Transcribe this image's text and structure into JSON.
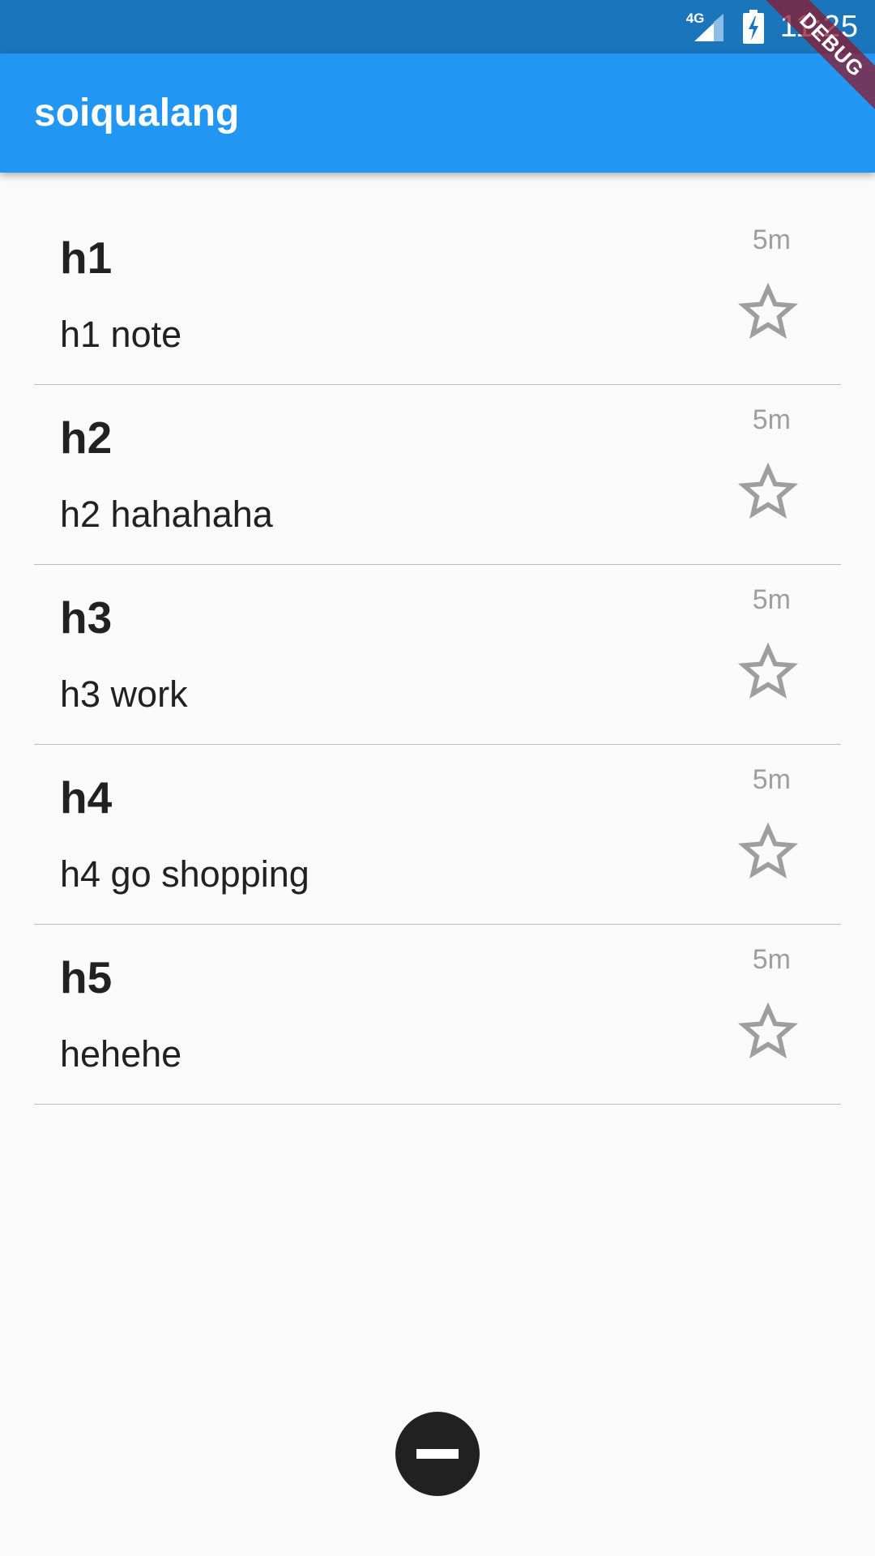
{
  "status_bar": {
    "network": "4G",
    "time": "11:25"
  },
  "app_bar": {
    "title": "soiqualang"
  },
  "debug_banner": "DEBUG",
  "notes": [
    {
      "title": "h1",
      "body": "h1 note",
      "time": "5m",
      "starred": false,
      "icon": "star-outline-icon"
    },
    {
      "title": "h2",
      "body": "h2 hahahaha",
      "time": "5m",
      "starred": false,
      "icon": "star-outline-icon"
    },
    {
      "title": "h3",
      "body": "h3 work",
      "time": "5m",
      "starred": false,
      "icon": "star-outline-icon"
    },
    {
      "title": "h4",
      "body": "h4 go shopping",
      "time": "5m",
      "starred": false,
      "icon": "star-outline-icon"
    },
    {
      "title": "h5",
      "body": "hehehe",
      "time": "5m",
      "starred": false,
      "icon": "star-outline-icon"
    }
  ],
  "fab": {
    "icon": "remove-circle-icon"
  },
  "colors": {
    "status_bar": "#1b75bb",
    "app_bar": "#2196f3",
    "fab": "#212121",
    "star": "#9e9e9e"
  }
}
